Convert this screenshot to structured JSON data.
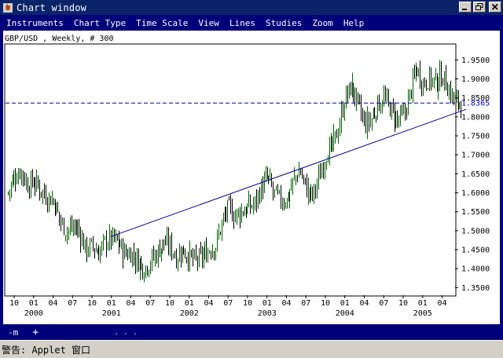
{
  "window": {
    "title": "Chart window"
  },
  "menu": [
    "Instruments",
    "Chart Type",
    "Time Scale",
    "View",
    "Lines",
    "Studies",
    "Zoom",
    "Help"
  ],
  "chart_data": {
    "type": "ohlc",
    "title": "GBP/USD , Weekly, # 300",
    "instrument": "GBP/USD",
    "timeframe": "Weekly",
    "bar_count": 300,
    "ylim": [
      1.33,
      1.99
    ],
    "y_ticks": [
      1.95,
      1.9,
      1.85,
      1.8,
      1.75,
      1.7,
      1.65,
      1.6,
      1.55,
      1.5,
      1.45,
      1.4,
      1.35
    ],
    "y_tick_labels": [
      "1.9500",
      "1.9000",
      "1.8500",
      "1.8000",
      "1.7500",
      "1.7000",
      "1.6500",
      "1.6000",
      "1.5500",
      "1.5000",
      "1.4500",
      "1.4000",
      "1.3500"
    ],
    "x_month_labels": [
      "10",
      "01",
      "04",
      "07",
      "10",
      "01",
      "04",
      "07",
      "10",
      "01",
      "04",
      "07",
      "10",
      "01",
      "04",
      "07",
      "10",
      "01",
      "04",
      "07",
      "10",
      "01",
      "04"
    ],
    "x_year_labels": [
      {
        "label": "2000",
        "month_index": 1
      },
      {
        "label": "2001",
        "month_index": 5
      },
      {
        "label": "2002",
        "month_index": 9
      },
      {
        "label": "2003",
        "month_index": 13
      },
      {
        "label": "2004",
        "month_index": 17
      },
      {
        "label": "2005",
        "month_index": 21
      }
    ],
    "current_price": 1.8365,
    "current_price_label": "1.8365",
    "trendline": {
      "from": {
        "date": "2001-01",
        "price": 1.485
      },
      "to": {
        "date": "2005-07",
        "price": 1.82
      }
    },
    "price_path": [
      [
        "1999-09",
        1.6
      ],
      [
        "1999-10",
        1.64
      ],
      [
        "1999-11",
        1.66
      ],
      [
        "1999-12",
        1.62
      ],
      [
        "2000-01",
        1.63
      ],
      [
        "2000-02",
        1.61
      ],
      [
        "2000-03",
        1.59
      ],
      [
        "2000-04",
        1.58
      ],
      [
        "2000-05",
        1.53
      ],
      [
        "2000-06",
        1.5
      ],
      [
        "2000-07",
        1.51
      ],
      [
        "2000-08",
        1.5
      ],
      [
        "2000-09",
        1.45
      ],
      [
        "2000-10",
        1.46
      ],
      [
        "2000-11",
        1.44
      ],
      [
        "2000-12",
        1.47
      ],
      [
        "2001-01",
        1.48
      ],
      [
        "2001-02",
        1.47
      ],
      [
        "2001-03",
        1.44
      ],
      [
        "2001-04",
        1.44
      ],
      [
        "2001-05",
        1.42
      ],
      [
        "2001-06",
        1.4
      ],
      [
        "2001-07",
        1.42
      ],
      [
        "2001-08",
        1.44
      ],
      [
        "2001-09",
        1.47
      ],
      [
        "2001-10",
        1.46
      ],
      [
        "2001-11",
        1.43
      ],
      [
        "2001-12",
        1.45
      ],
      [
        "2002-01",
        1.43
      ],
      [
        "2002-02",
        1.42
      ],
      [
        "2002-03",
        1.43
      ],
      [
        "2002-04",
        1.45
      ],
      [
        "2002-05",
        1.46
      ],
      [
        "2002-06",
        1.52
      ],
      [
        "2002-07",
        1.56
      ],
      [
        "2002-08",
        1.54
      ],
      [
        "2002-09",
        1.55
      ],
      [
        "2002-10",
        1.56
      ],
      [
        "2002-11",
        1.57
      ],
      [
        "2002-12",
        1.61
      ],
      [
        "2003-01",
        1.64
      ],
      [
        "2003-02",
        1.6
      ],
      [
        "2003-03",
        1.58
      ],
      [
        "2003-04",
        1.58
      ],
      [
        "2003-05",
        1.63
      ],
      [
        "2003-06",
        1.66
      ],
      [
        "2003-07",
        1.61
      ],
      [
        "2003-08",
        1.59
      ],
      [
        "2003-09",
        1.64
      ],
      [
        "2003-10",
        1.7
      ],
      [
        "2003-11",
        1.72
      ],
      [
        "2003-12",
        1.77
      ],
      [
        "2004-01",
        1.85
      ],
      [
        "2004-02",
        1.88
      ],
      [
        "2004-03",
        1.83
      ],
      [
        "2004-04",
        1.78
      ],
      [
        "2004-05",
        1.79
      ],
      [
        "2004-06",
        1.83
      ],
      [
        "2004-07",
        1.85
      ],
      [
        "2004-08",
        1.82
      ],
      [
        "2004-09",
        1.79
      ],
      [
        "2004-10",
        1.8
      ],
      [
        "2004-11",
        1.86
      ],
      [
        "2004-12",
        1.93
      ],
      [
        "2005-01",
        1.89
      ],
      [
        "2005-02",
        1.9
      ],
      [
        "2005-03",
        1.89
      ],
      [
        "2005-04",
        1.91
      ],
      [
        "2005-05",
        1.87
      ],
      [
        "2005-06",
        1.84
      ]
    ]
  },
  "statusbar": {
    "tool_one": "-m",
    "tool_two": "+",
    "dots": ". . ."
  },
  "applet_warning": "警告: Applet 窗口"
}
